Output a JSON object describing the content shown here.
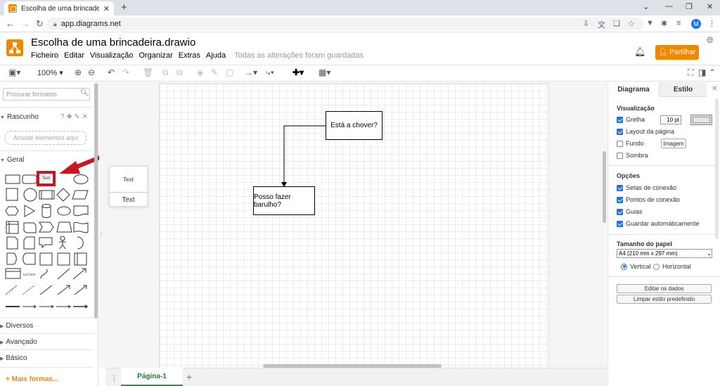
{
  "browser": {
    "tab_title": "Escolha de uma brincadeira.drawio",
    "url": "app.diagrams.net",
    "profile_initial": "M"
  },
  "app": {
    "doc_title": "Escolha de uma brincadeira.drawio",
    "menu": [
      "Ficheiro",
      "Editar",
      "Visualização",
      "Organizar",
      "Extras",
      "Ajuda"
    ],
    "save_status": "Todas as alterações foram guardadas",
    "share_label": "Partilhar",
    "accent": "#f08705"
  },
  "toolbar": {
    "zoom": "100%"
  },
  "sidebar": {
    "search_placeholder": "Procurar formatos",
    "scratchpad_title": "Rascunho",
    "scratchpad_hint": "Arraste elementos aqui",
    "general_title": "Geral",
    "text_shape_label": "Text",
    "list_item_label": "List Item",
    "sections": [
      "Diversos",
      "Avançado",
      "Básico"
    ],
    "more_shapes": "+ Mais formas..."
  },
  "preview": {
    "top_label": "Text",
    "bottom_label": "Text"
  },
  "diagram": {
    "nodes": [
      {
        "id": "n1",
        "label": "Está a chover?"
      },
      {
        "id": "n2",
        "label": "Posso fazer barulho?"
      }
    ]
  },
  "pages": {
    "current": "Página-1"
  },
  "format_panel": {
    "tab_diagram": "Diagrama",
    "tab_style": "Estilo",
    "view_title": "Visualização",
    "grid_label": "Grelha",
    "grid_size": "10 pt",
    "page_view_label": "Layout da página",
    "background_label": "Fundo",
    "image_button": "Imagem",
    "shadow_label": "Sombra",
    "options_title": "Opções",
    "connection_arrows": "Setas de conexão",
    "connection_points": "Pontos de conexão",
    "guides": "Guias",
    "autosave": "Guardar automáticamente",
    "paper_size_title": "Tamanho do papel",
    "paper_size_value": "A4 (210 mm x 297 mm)",
    "portrait": "Vertical",
    "landscape": "Horizontal",
    "edit_data": "Editar os dados",
    "clear_style": "Limpar estilo predefinido"
  }
}
